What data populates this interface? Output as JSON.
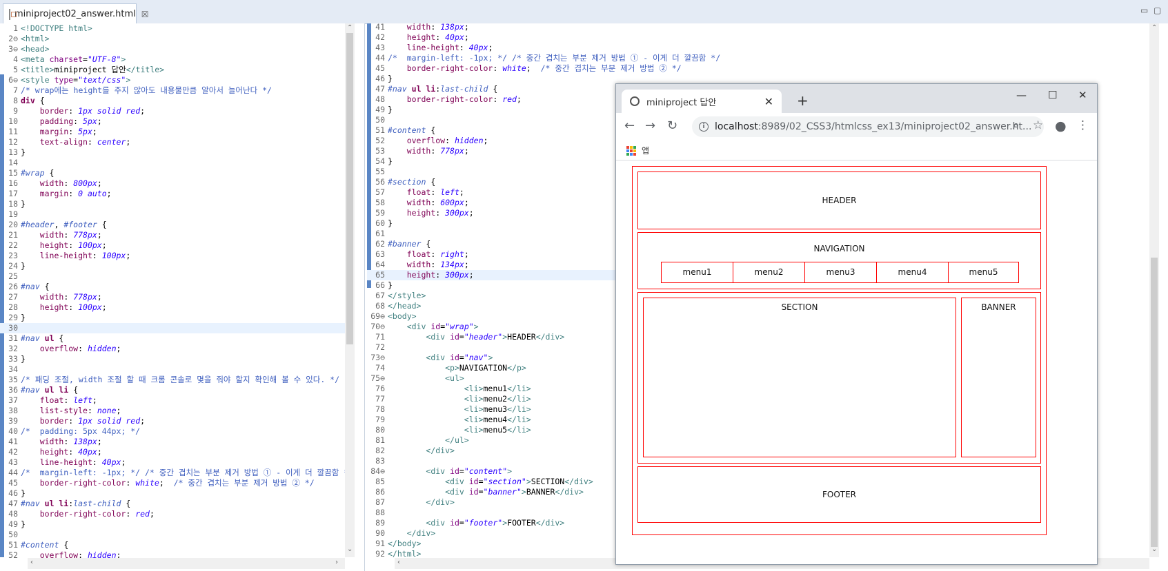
{
  "editor_tab": {
    "title": "miniproject02_answer.html",
    "close": "☒"
  },
  "left_lines": [
    {
      "n": "1",
      "html": "<span class='tag'>&lt;!DOCTYPE html&gt;</span>"
    },
    {
      "n": "2⊖",
      "html": "<span class='tag'>&lt;html&gt;</span>"
    },
    {
      "n": "3⊖",
      "html": "<span class='tag'>&lt;head&gt;</span>"
    },
    {
      "n": "4",
      "html": "<span class='tag'>&lt;meta </span><span class='attr'>charset</span>=<span class='str'>\"UTF-8\"</span><span class='tag'>&gt;</span>"
    },
    {
      "n": "5",
      "html": "<span class='tag'>&lt;title&gt;</span>miniproject 답안<span class='tag'>&lt;/title&gt;</span>"
    },
    {
      "n": "6⊖",
      "html": "<span class='tag'>&lt;style </span><span class='attr'>type</span>=<span class='str'>\"text/css\"</span><span class='tag'>&gt;</span>"
    },
    {
      "n": "7",
      "html": "<span class='cm'>/* wrap에는 height를 주지 않아도 내용물만큼 알아서 늘어난다 */</span>"
    },
    {
      "n": "8",
      "html": "<span class='k'>div</span> {"
    },
    {
      "n": "9",
      "html": "    <span class='prop'>border</span>: <span class='val'>1px solid red</span>;"
    },
    {
      "n": "10",
      "html": "    <span class='prop'>padding</span>: <span class='val'>5px</span>;"
    },
    {
      "n": "11",
      "html": "    <span class='prop'>margin</span>: <span class='val'>5px</span>;"
    },
    {
      "n": "12",
      "html": "    <span class='prop'>text-align</span>: <span class='val'>center</span>;"
    },
    {
      "n": "13",
      "html": "}"
    },
    {
      "n": "14",
      "html": ""
    },
    {
      "n": "15",
      "html": "<span class='id'>#wrap</span> {"
    },
    {
      "n": "16",
      "html": "    <span class='prop'>width</span>: <span class='val'>800px</span>;"
    },
    {
      "n": "17",
      "html": "    <span class='prop'>margin</span>: <span class='val'>0 auto</span>;"
    },
    {
      "n": "18",
      "html": "}"
    },
    {
      "n": "19",
      "html": ""
    },
    {
      "n": "20",
      "html": "<span class='id'>#header</span>, <span class='id'>#footer</span> {"
    },
    {
      "n": "21",
      "html": "    <span class='prop'>width</span>: <span class='val'>778px</span>;"
    },
    {
      "n": "22",
      "html": "    <span class='prop'>height</span>: <span class='val'>100px</span>;"
    },
    {
      "n": "23",
      "html": "    <span class='prop'>line-height</span>: <span class='val'>100px</span>;"
    },
    {
      "n": "24",
      "html": "}"
    },
    {
      "n": "25",
      "html": ""
    },
    {
      "n": "26",
      "html": "<span class='id'>#nav</span> {"
    },
    {
      "n": "27",
      "html": "    <span class='prop'>width</span>: <span class='val'>778px</span>;"
    },
    {
      "n": "28",
      "html": "    <span class='prop'>height</span>: <span class='val'>100px</span>;"
    },
    {
      "n": "29",
      "html": "}"
    },
    {
      "n": "30",
      "html": "",
      "hl": true
    },
    {
      "n": "31",
      "html": "<span class='id'>#nav</span> <span class='k'>ul</span> {"
    },
    {
      "n": "32",
      "html": "    <span class='prop'>overflow</span>: <span class='val'>hidden</span>;"
    },
    {
      "n": "33",
      "html": "}"
    },
    {
      "n": "34",
      "html": ""
    },
    {
      "n": "35",
      "html": "<span class='cm'>/* 패딩 조절, width 조절 할 때 크롬 콘솔로 몇을 줘야 할지 확인해 볼 수 있다. */</span>"
    },
    {
      "n": "36",
      "html": "<span class='id'>#nav</span> <span class='k'>ul li</span> {"
    },
    {
      "n": "37",
      "html": "    <span class='prop'>float</span>: <span class='val'>left</span>;"
    },
    {
      "n": "38",
      "html": "    <span class='prop'>list-style</span>: <span class='val'>none</span>;"
    },
    {
      "n": "39",
      "html": "    <span class='prop'>border</span>: <span class='val'>1px solid red</span>;"
    },
    {
      "n": "40",
      "html": "<span class='cm'>/*  padding: 5px 44px; */</span>"
    },
    {
      "n": "41",
      "html": "    <span class='prop'>width</span>: <span class='val'>138px</span>;"
    },
    {
      "n": "42",
      "html": "    <span class='prop'>height</span>: <span class='val'>40px</span>;"
    },
    {
      "n": "43",
      "html": "    <span class='prop'>line-height</span>: <span class='val'>40px</span>;"
    },
    {
      "n": "44",
      "html": "<span class='cm'>/*  margin-left: -1px; */ /* 중간 겹치는 부분 제거 방법 ① - 이게 더 깔끔함 */</span>"
    },
    {
      "n": "45",
      "html": "    <span class='prop'>border-right-color</span>: <span class='val'>white</span>;  <span class='cm'>/* 중간 겹치는 부분 제거 방법 ② */</span>"
    },
    {
      "n": "46",
      "html": "}"
    },
    {
      "n": "47",
      "html": "<span class='id'>#nav</span> <span class='k'>ul li</span>:<span class='id'>last-child</span> {"
    },
    {
      "n": "48",
      "html": "    <span class='prop'>border-right-color</span>: <span class='val'>red</span>;"
    },
    {
      "n": "49",
      "html": "}"
    },
    {
      "n": "50",
      "html": ""
    },
    {
      "n": "51",
      "html": "<span class='id'>#content</span> {"
    },
    {
      "n": "52",
      "html": "    <span class='prop'>overflow</span>: <span class='val'>hidden</span>;"
    }
  ],
  "right_lines": [
    {
      "n": "41",
      "html": "    <span class='prop'>width</span>: <span class='val'>138px</span>;"
    },
    {
      "n": "42",
      "html": "    <span class='prop'>height</span>: <span class='val'>40px</span>;"
    },
    {
      "n": "43",
      "html": "    <span class='prop'>line-height</span>: <span class='val'>40px</span>;"
    },
    {
      "n": "44",
      "html": "<span class='cm'>/*  margin-left: -1px; */ /* 중간 겹치는 부분 제거 방법 ① - 이게 더 깔끔함 */</span>"
    },
    {
      "n": "45",
      "html": "    <span class='prop'>border-right-color</span>: <span class='val'>white</span>;  <span class='cm'>/* 중간 겹치는 부분 제거 방법 ② */</span>"
    },
    {
      "n": "46",
      "html": "}"
    },
    {
      "n": "47",
      "html": "<span class='id'>#nav</span> <span class='k'>ul li</span>:<span class='id'>last-child</span> {"
    },
    {
      "n": "48",
      "html": "    <span class='prop'>border-right-color</span>: <span class='val'>red</span>;"
    },
    {
      "n": "49",
      "html": "}"
    },
    {
      "n": "50",
      "html": ""
    },
    {
      "n": "51",
      "html": "<span class='id'>#content</span> {"
    },
    {
      "n": "52",
      "html": "    <span class='prop'>overflow</span>: <span class='val'>hidden</span>;"
    },
    {
      "n": "53",
      "html": "    <span class='prop'>width</span>: <span class='val'>778px</span>;"
    },
    {
      "n": "54",
      "html": "}"
    },
    {
      "n": "55",
      "html": ""
    },
    {
      "n": "56",
      "html": "<span class='id'>#section</span> {"
    },
    {
      "n": "57",
      "html": "    <span class='prop'>float</span>: <span class='val'>left</span>;"
    },
    {
      "n": "58",
      "html": "    <span class='prop'>width</span>: <span class='val'>600px</span>;"
    },
    {
      "n": "59",
      "html": "    <span class='prop'>height</span>: <span class='val'>300px</span>;"
    },
    {
      "n": "60",
      "html": "}"
    },
    {
      "n": "61",
      "html": ""
    },
    {
      "n": "62",
      "html": "<span class='id'>#banner</span> {"
    },
    {
      "n": "63",
      "html": "    <span class='prop'>float</span>: <span class='val'>right</span>;"
    },
    {
      "n": "64",
      "html": "    <span class='prop'>width</span>: <span class='val'>134px</span>;"
    },
    {
      "n": "65",
      "html": "    <span class='prop'>height</span>: <span class='val'>300px</span>;",
      "hl": true
    },
    {
      "n": "66",
      "html": "}"
    },
    {
      "n": "67",
      "html": "<span class='tag'>&lt;/style&gt;</span>"
    },
    {
      "n": "68",
      "html": "<span class='tag'>&lt;/head&gt;</span>"
    },
    {
      "n": "69⊖",
      "html": "<span class='tag'>&lt;body&gt;</span>"
    },
    {
      "n": "70⊖",
      "html": "    <span class='tag'>&lt;div </span><span class='attr'>id</span>=<span class='str'>\"wrap\"</span><span class='tag'>&gt;</span>"
    },
    {
      "n": "71",
      "html": "        <span class='tag'>&lt;div </span><span class='attr'>id</span>=<span class='str'>\"header\"</span><span class='tag'>&gt;</span>HEADER<span class='tag'>&lt;/div&gt;</span>"
    },
    {
      "n": "72",
      "html": ""
    },
    {
      "n": "73⊖",
      "html": "        <span class='tag'>&lt;div </span><span class='attr'>id</span>=<span class='str'>\"nav\"</span><span class='tag'>&gt;</span>"
    },
    {
      "n": "74",
      "html": "            <span class='tag'>&lt;p&gt;</span>NAVIGATION<span class='tag'>&lt;/p&gt;</span>"
    },
    {
      "n": "75⊖",
      "html": "            <span class='tag'>&lt;ul&gt;</span>"
    },
    {
      "n": "76",
      "html": "                <span class='tag'>&lt;li&gt;</span>menu1<span class='tag'>&lt;/li&gt;</span>"
    },
    {
      "n": "77",
      "html": "                <span class='tag'>&lt;li&gt;</span>menu2<span class='tag'>&lt;/li&gt;</span>"
    },
    {
      "n": "78",
      "html": "                <span class='tag'>&lt;li&gt;</span>menu3<span class='tag'>&lt;/li&gt;</span>"
    },
    {
      "n": "79",
      "html": "                <span class='tag'>&lt;li&gt;</span>menu4<span class='tag'>&lt;/li&gt;</span>"
    },
    {
      "n": "80",
      "html": "                <span class='tag'>&lt;li&gt;</span>menu5<span class='tag'>&lt;/li&gt;</span>"
    },
    {
      "n": "81",
      "html": "            <span class='tag'>&lt;/ul&gt;</span>"
    },
    {
      "n": "82",
      "html": "        <span class='tag'>&lt;/div&gt;</span>"
    },
    {
      "n": "83",
      "html": ""
    },
    {
      "n": "84⊖",
      "html": "        <span class='tag'>&lt;div </span><span class='attr'>id</span>=<span class='str'>\"content\"</span><span class='tag'>&gt;</span>"
    },
    {
      "n": "85",
      "html": "            <span class='tag'>&lt;div </span><span class='attr'>id</span>=<span class='str'>\"section\"</span><span class='tag'>&gt;</span>SECTION<span class='tag'>&lt;/div&gt;</span>"
    },
    {
      "n": "86",
      "html": "            <span class='tag'>&lt;div </span><span class='attr'>id</span>=<span class='str'>\"banner\"</span><span class='tag'>&gt;</span>BANNER<span class='tag'>&lt;/div&gt;</span>"
    },
    {
      "n": "87",
      "html": "        <span class='tag'>&lt;/div&gt;</span>"
    },
    {
      "n": "88",
      "html": ""
    },
    {
      "n": "89",
      "html": "        <span class='tag'>&lt;div </span><span class='attr'>id</span>=<span class='str'>\"footer\"</span><span class='tag'>&gt;</span>FOOTER<span class='tag'>&lt;/div&gt;</span>"
    },
    {
      "n": "90",
      "html": "    <span class='tag'>&lt;/div&gt;</span>"
    },
    {
      "n": "91",
      "html": "<span class='tag'>&lt;/body&gt;</span>"
    },
    {
      "n": "92",
      "html": "<span class='tag'>&lt;/html&gt;</span>"
    }
  ],
  "browser": {
    "tab_title": "miniproject 답안",
    "url_host": "localhost",
    "url_path": ":8989/02_CSS3/htmlcss_ex13/miniproject02_answer.ht...",
    "bookmark_apps": "앱",
    "page": {
      "header": "HEADER",
      "navigation": "NAVIGATION",
      "menus": [
        "menu1",
        "menu2",
        "menu3",
        "menu4",
        "menu5"
      ],
      "section": "SECTION",
      "banner": "BANNER",
      "footer": "FOOTER"
    }
  },
  "colors": {
    "box_border": "#ff0000",
    "ruler": "#5a86c5",
    "highlight": "#e8f2fe"
  },
  "icons": [
    "file-html-icon",
    "close-tab-icon",
    "minimize-icon",
    "maximize-icon",
    "globe-icon",
    "new-tab-icon",
    "back-icon",
    "forward-icon",
    "reload-icon",
    "info-icon",
    "zoom-icon",
    "star-icon",
    "account-icon",
    "menu-dots-icon",
    "apps-grid-icon"
  ]
}
